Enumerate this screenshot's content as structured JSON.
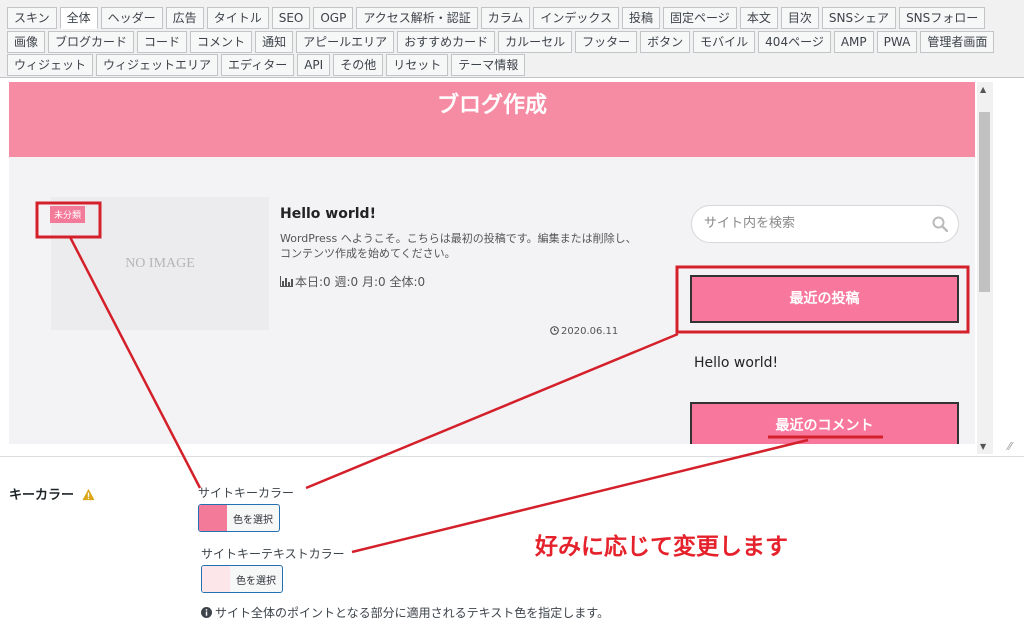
{
  "tabs": {
    "row1": [
      "スキン",
      "全体",
      "ヘッダー",
      "広告",
      "タイトル",
      "SEO",
      "OGP",
      "アクセス解析・認証",
      "カラム",
      "インデックス",
      "投稿",
      "固定ページ",
      "本文",
      "目次",
      "SNSシェア",
      "SNSフォロー"
    ],
    "row2": [
      "画像",
      "ブログカード",
      "コード",
      "コメント",
      "通知",
      "アピールエリア",
      "おすすめカード",
      "カルーセル",
      "フッター",
      "ボタン",
      "モバイル",
      "404ページ",
      "AMP",
      "PWA",
      "管理者画面"
    ],
    "row3": [
      "ウィジェット",
      "ウィジェットエリア",
      "エディター",
      "API",
      "その他",
      "リセット",
      "テーマ情報"
    ],
    "active": "全体"
  },
  "preview": {
    "site_title": "ブログ作成",
    "no_image": "NO IMAGE",
    "category_badge": "未分類",
    "post_title": "Hello world!",
    "post_excerpt": "WordPress へようこそ。こちらは最初の投稿です。編集または削除し、コンテンツ作成を始めてください。",
    "post_stats": "本日:0 週:0 月:0 全体:0",
    "post_date": "2020.06.11",
    "search_placeholder": "サイト内を検索",
    "widget_recent_posts": "最近の投稿",
    "recent_post_item": "Hello world!",
    "widget_recent_comments": "最近のコメント"
  },
  "settings": {
    "section_label": "キーカラー",
    "site_key_color_label": "サイトキーカラー",
    "site_key_color_button": "色を選択",
    "site_key_color_value": "#f47a99",
    "site_key_text_color_label": "サイトキーテキストカラー",
    "site_key_text_color_button": "色を選択",
    "site_key_text_color_value": "#fde6e9",
    "help_text": "サイト全体のポイントとなる部分に適用されるテキスト色を指定します。"
  },
  "annotation": {
    "note": "好みに応じて変更します",
    "color": "#e5222b"
  },
  "colors": {
    "header_pink": "#f68ca3",
    "widget_pink": "#f7789c",
    "annotation_red": "#e5222b"
  },
  "icons": [
    "chart-icon",
    "clock-icon",
    "search-icon",
    "warning-icon",
    "info-icon"
  ]
}
